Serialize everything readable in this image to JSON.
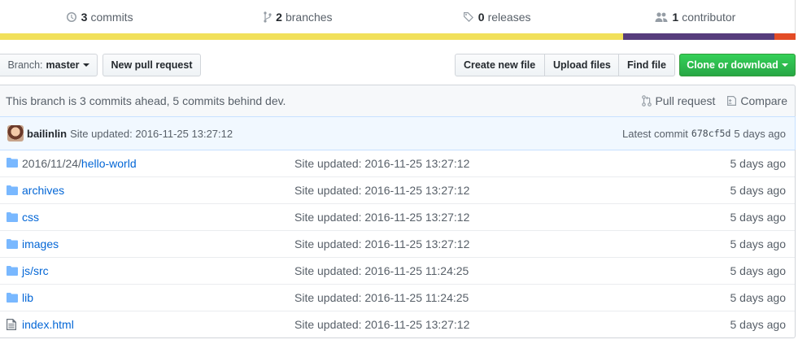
{
  "summary": {
    "commits": {
      "count": "3",
      "label": "commits"
    },
    "branches": {
      "count": "2",
      "label": "branches"
    },
    "releases": {
      "count": "0",
      "label": "releases"
    },
    "contributors": {
      "count": "1",
      "label": "contributor"
    }
  },
  "language_bar": [
    {
      "color": "#f1e05a",
      "share": 0.783
    },
    {
      "color": "#563d7c",
      "share": 0.19
    },
    {
      "color": "#e34c26",
      "share": 0.027
    }
  ],
  "toolbar": {
    "branch_prefix": "Branch:",
    "branch_name": "master",
    "new_pull_request": "New pull request",
    "create_new_file": "Create new file",
    "upload_files": "Upload files",
    "find_file": "Find file",
    "clone_or_download": "Clone or download"
  },
  "branch_info": {
    "text": "This branch is 3 commits ahead, 5 commits behind dev.",
    "pull_request": "Pull request",
    "compare": "Compare"
  },
  "latest_commit": {
    "author": "bailinlin",
    "message": "Site updated: 2016-11-25 13:27:12",
    "label": "Latest commit",
    "sha": "678cf5d",
    "age": "5 days ago"
  },
  "files": [
    {
      "type": "dir",
      "prefix": "2016/11/24/",
      "name": "hello-world",
      "message": "Site updated: 2016-11-25 13:27:12",
      "age": "5 days ago"
    },
    {
      "type": "dir",
      "prefix": "",
      "name": "archives",
      "message": "Site updated: 2016-11-25 13:27:12",
      "age": "5 days ago"
    },
    {
      "type": "dir",
      "prefix": "",
      "name": "css",
      "message": "Site updated: 2016-11-25 13:27:12",
      "age": "5 days ago"
    },
    {
      "type": "dir",
      "prefix": "",
      "name": "images",
      "message": "Site updated: 2016-11-25 13:27:12",
      "age": "5 days ago"
    },
    {
      "type": "dir",
      "prefix": "",
      "name": "js/src",
      "message": "Site updated: 2016-11-25 11:24:25",
      "age": "5 days ago"
    },
    {
      "type": "dir",
      "prefix": "",
      "name": "lib",
      "message": "Site updated: 2016-11-25 11:24:25",
      "age": "5 days ago"
    },
    {
      "type": "file",
      "prefix": "",
      "name": "index.html",
      "message": "Site updated: 2016-11-25 13:27:12",
      "age": "5 days ago"
    }
  ],
  "colors": {
    "link": "#0366d6",
    "folder_icon": "#79b8ff",
    "green_button": "#28a745"
  }
}
